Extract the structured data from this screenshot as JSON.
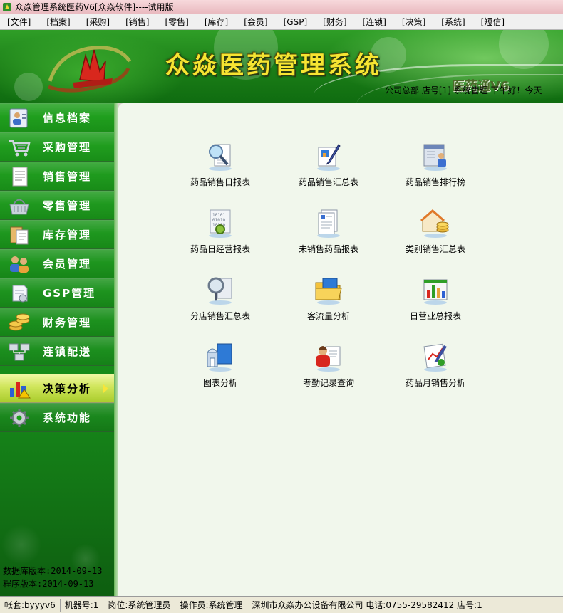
{
  "window": {
    "title": "众焱管理系统医药V6[众焱软件]----试用版"
  },
  "menu": [
    {
      "label": "[文件]"
    },
    {
      "label": "[档案]"
    },
    {
      "label": "[采购]"
    },
    {
      "label": "[销售]"
    },
    {
      "label": "[零售]"
    },
    {
      "label": "[库存]"
    },
    {
      "label": "[会员]"
    },
    {
      "label": "[GSP]"
    },
    {
      "label": "[财务]"
    },
    {
      "label": "[连锁]"
    },
    {
      "label": "[决策]"
    },
    {
      "label": "[系统]"
    },
    {
      "label": "[短信]"
    }
  ],
  "banner": {
    "title": "众焱医药管理系统",
    "subtitle": "医药通V6",
    "info": "公司总部  店号[1]  系统管理  下午好！今天"
  },
  "sidebar": {
    "items": [
      {
        "label": "信息档案",
        "icon": "profile-card-icon"
      },
      {
        "label": "采购管理",
        "icon": "shopping-cart-icon"
      },
      {
        "label": "销售管理",
        "icon": "document-icon"
      },
      {
        "label": "零售管理",
        "icon": "basket-icon"
      },
      {
        "label": "库存管理",
        "icon": "clipboard-icon"
      },
      {
        "label": "会员管理",
        "icon": "members-icon"
      },
      {
        "label": "GSP管理",
        "icon": "gsp-icon"
      },
      {
        "label": "财务管理",
        "icon": "coins-icon"
      },
      {
        "label": "连锁配送",
        "icon": "network-icon"
      },
      {
        "label": "决策分析",
        "icon": "chart-icon",
        "active": true
      },
      {
        "label": "系统功能",
        "icon": "gear-icon"
      }
    ],
    "db_version": "数据库版本:2014-09-13",
    "app_version": "程序版本:2014-09-13"
  },
  "reports": [
    {
      "label": "药品销售日报表",
      "icon": "magnifier-report-icon"
    },
    {
      "label": "药品销售汇总表",
      "icon": "pen-report-icon"
    },
    {
      "label": "药品销售排行榜",
      "icon": "ranking-report-icon"
    },
    {
      "label": "药品日经营报表",
      "icon": "binary-data-icon"
    },
    {
      "label": "未销售药品报表",
      "icon": "paper-list-icon"
    },
    {
      "label": "类别销售汇总表",
      "icon": "house-coins-icon"
    },
    {
      "label": "分店销售汇总表",
      "icon": "search-branch-icon"
    },
    {
      "label": "客流量分析",
      "icon": "folder-icon"
    },
    {
      "label": "日营业总报表",
      "icon": "bar-chart-icon"
    },
    {
      "label": "图表分析",
      "icon": "chart-folder-icon"
    },
    {
      "label": "考勤记录查询",
      "icon": "attendance-icon"
    },
    {
      "label": "药品月销售分析",
      "icon": "monthly-analysis-icon"
    }
  ],
  "status": {
    "account": "帐套:byyyv6",
    "machine": "机器号:1",
    "post": "岗位:系统管理员",
    "operator": "操作员:系统管理",
    "company": "深圳市众焱办公设备有限公司  电话:0755-29582412  店号:1"
  },
  "colors": {
    "sidebar_green": "#1c9e1a",
    "active_item": "#cfe55a",
    "banner_title": "#f6e532",
    "content_bg": "#f1f7ec"
  }
}
